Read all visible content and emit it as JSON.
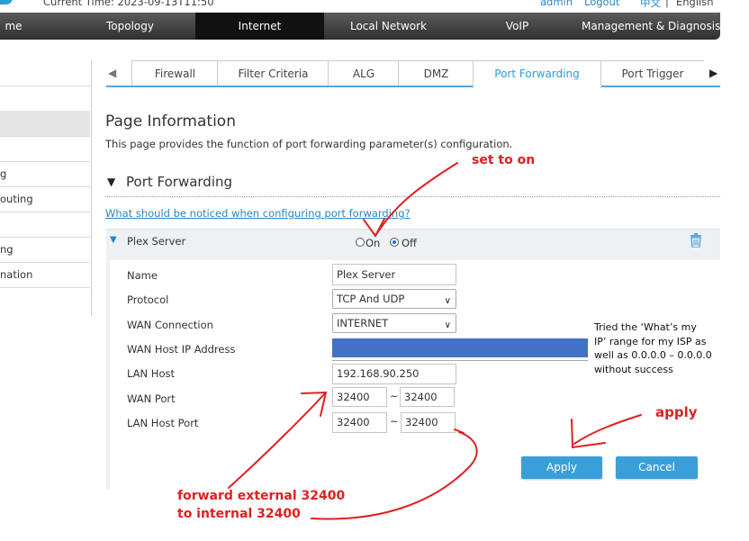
{
  "header": {
    "current_time": "Current Time: 2023-09-13T11:50",
    "admin_link": "admin",
    "logout_link": "Logout",
    "lang_zh": "中文",
    "lang_separator": "|",
    "lang_en": "English"
  },
  "nav": {
    "items": [
      {
        "label": "me"
      },
      {
        "label": "Topology"
      },
      {
        "label": "Internet"
      },
      {
        "label": "Local Network"
      },
      {
        "label": "VoIP"
      },
      {
        "label": "Management & Diagnosis"
      }
    ]
  },
  "sidebar": {
    "items": [
      {
        "label": ""
      },
      {
        "label": ""
      },
      {
        "label": ""
      },
      {
        "label": ""
      },
      {
        "label": "g"
      },
      {
        "label": "outing"
      },
      {
        "label": ""
      },
      {
        "label": "ng"
      },
      {
        "label": "nation"
      }
    ]
  },
  "tabs": {
    "left_arrow": "◀",
    "right_arrow": "▶",
    "items": [
      {
        "label": "Firewall"
      },
      {
        "label": "Filter Criteria"
      },
      {
        "label": "ALG"
      },
      {
        "label": "DMZ"
      },
      {
        "label": "Port Forwarding"
      },
      {
        "label": "Port Trigger"
      }
    ]
  },
  "page": {
    "title": "Page Information",
    "description": "This page provides the function of port forwarding parameter(s) configuration.",
    "section_toggle": "▼",
    "section_title": "Port Forwarding",
    "help_link": "What should be noticed when configuring port forwarding?"
  },
  "rule": {
    "toggle": "▼",
    "name": "Plex Server",
    "on_label": "On",
    "off_label": "Off",
    "selected": "Off",
    "delete_icon": "trash-icon"
  },
  "form": {
    "name_label": "Name",
    "name_value": "Plex Server",
    "protocol_label": "Protocol",
    "protocol_value": "TCP And UDP",
    "wan_connection_label": "WAN Connection",
    "wan_connection_value": "INTERNET",
    "wan_host_ip_label": "WAN Host IP Address",
    "lan_host_label": "LAN Host",
    "lan_host_value": "192.168.90.250",
    "wan_port_label": "WAN Port",
    "wan_port_start": "32400",
    "wan_port_end": "32400",
    "lan_port_label": "LAN Host Port",
    "lan_port_start": "32400",
    "lan_port_end": "32400",
    "range_sep": "~",
    "apply_label": "Apply",
    "cancel_label": "Cancel"
  },
  "annotations": {
    "set_to_on": "set to on",
    "apply": "apply",
    "forward_line1": "forward external 32400",
    "forward_line2": "to internal 32400",
    "note_line1": "Tried the ‘What’s my",
    "note_line2": "IP’ range for my ISP as",
    "note_line3": "well as 0.0.0.0 – 0.0.0.0",
    "note_line4": "without  success"
  },
  "colors": {
    "accent": "#2a9fd6",
    "redaction": "#4472c4",
    "annotation": "#e02020",
    "button": "#3a9fd8"
  }
}
